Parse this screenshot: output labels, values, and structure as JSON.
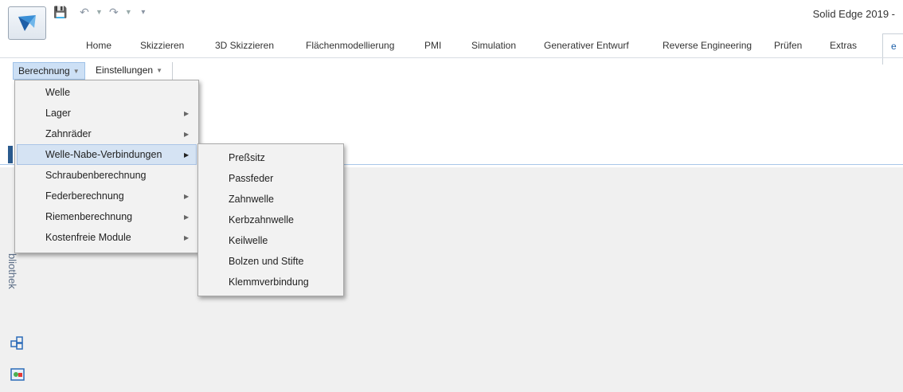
{
  "window": {
    "title": "Solid Edge 2019 -"
  },
  "quick_access": {
    "save_icon": "save-icon",
    "undo_icon": "undo-icon",
    "redo_icon": "redo-icon",
    "customize_icon": "customize-dropdown-icon"
  },
  "ribbon": {
    "tabs": [
      "Home",
      "Skizzieren",
      "3D Skizzieren",
      "Flächenmodellierung",
      "PMI",
      "Simulation",
      "Generativer Entwurf",
      "Reverse Engineering",
      "Prüfen",
      "Extras",
      "e"
    ],
    "buttons": {
      "berechnung": "Berechnung",
      "einstellungen": "Einstellungen"
    }
  },
  "menu": {
    "items": [
      {
        "label": "Welle",
        "submenu": false
      },
      {
        "label": "Lager",
        "submenu": true
      },
      {
        "label": "Zahnräder",
        "submenu": true
      },
      {
        "label": "Welle-Nabe-Verbindungen",
        "submenu": true,
        "highlighted": true
      },
      {
        "label": "Schraubenberechnung",
        "submenu": false
      },
      {
        "label": "Federberechnung",
        "submenu": true
      },
      {
        "label": "Riemenberechnung",
        "submenu": true
      },
      {
        "label": "Kostenfreie Module",
        "submenu": true
      }
    ]
  },
  "submenu": {
    "items": [
      "Preßsitz",
      "Passfeder",
      "Zahnwelle",
      "Kerbzahnwelle",
      "Keilwelle",
      "Bolzen und Stifte",
      "Klemmverbindung"
    ]
  },
  "side_panel": {
    "vertical_label": "bliothek"
  },
  "colors": {
    "accent": "#1a5ea8",
    "highlight": "#d5e3f3",
    "menu_bg": "#f2f2f2"
  }
}
